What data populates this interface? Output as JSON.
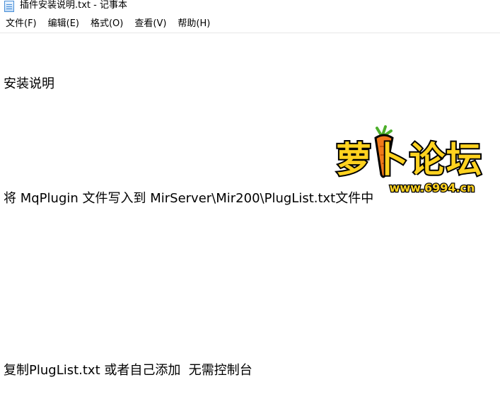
{
  "window": {
    "title": "插件安装说明.txt - 记事本",
    "icon": "notepad-icon"
  },
  "menu": [
    {
      "label": "文件(F)"
    },
    {
      "label": "编辑(E)"
    },
    {
      "label": "格式(O)"
    },
    {
      "label": "查看(V)"
    },
    {
      "label": "帮助(H)"
    }
  ],
  "editor": {
    "lines": [
      "安装说明",
      "",
      "将 MqPlugin 文件写入到 MirServer\\Mir200\\PlugList.txt文件中",
      "",
      "",
      "复制PlugList.txt 或者自己添加  无需控制台"
    ]
  },
  "watermark": {
    "logo_text": "萝卜论坛",
    "url": "www.6994.cn",
    "colors": {
      "text_fill": "#ffd21f",
      "outline": "#000000",
      "carrot": "#f07a1a",
      "leaf": "#4caf2a"
    }
  }
}
